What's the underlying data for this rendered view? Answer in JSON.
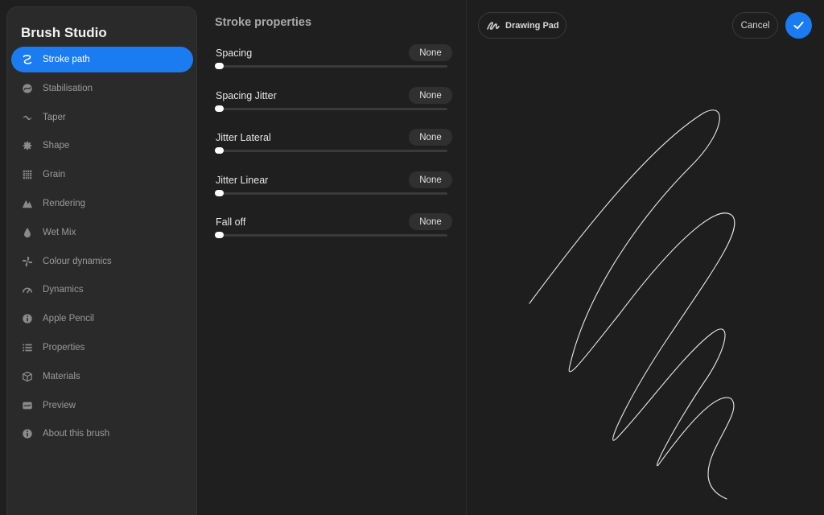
{
  "app": {
    "title": "Brush Studio"
  },
  "sidebar": {
    "items": [
      {
        "label": "Stroke path",
        "icon": "stroke-path-icon",
        "active": true
      },
      {
        "label": "Stabilisation",
        "icon": "stabilisation-icon"
      },
      {
        "label": "Taper",
        "icon": "taper-icon"
      },
      {
        "label": "Shape",
        "icon": "shape-icon"
      },
      {
        "label": "Grain",
        "icon": "grain-icon"
      },
      {
        "label": "Rendering",
        "icon": "rendering-icon"
      },
      {
        "label": "Wet Mix",
        "icon": "wet-mix-icon"
      },
      {
        "label": "Colour dynamics",
        "icon": "colour-dynamics-icon"
      },
      {
        "label": "Dynamics",
        "icon": "dynamics-icon"
      },
      {
        "label": "Apple Pencil",
        "icon": "apple-pencil-icon"
      },
      {
        "label": "Properties",
        "icon": "properties-icon"
      },
      {
        "label": "Materials",
        "icon": "materials-icon"
      },
      {
        "label": "Preview",
        "icon": "preview-icon"
      },
      {
        "label": "About this brush",
        "icon": "info-icon"
      }
    ]
  },
  "panel": {
    "title": "Stroke properties",
    "properties": [
      {
        "label": "Spacing",
        "value": "None",
        "level": 0
      },
      {
        "label": "Spacing Jitter",
        "value": "None",
        "level": 0
      },
      {
        "label": "Jitter Lateral",
        "value": "None",
        "level": 0
      },
      {
        "label": "Jitter Linear",
        "value": "None",
        "level": 0
      },
      {
        "label": "Fall off",
        "value": "None",
        "level": 0
      }
    ]
  },
  "pad": {
    "drawing_pad_label": "Drawing Pad",
    "cancel_label": "Cancel",
    "confirm_icon": "checkmark-icon"
  },
  "colors": {
    "accent": "#1b7cf2",
    "background": "#1f1f1f",
    "sidebar": "#2a2a2a"
  }
}
